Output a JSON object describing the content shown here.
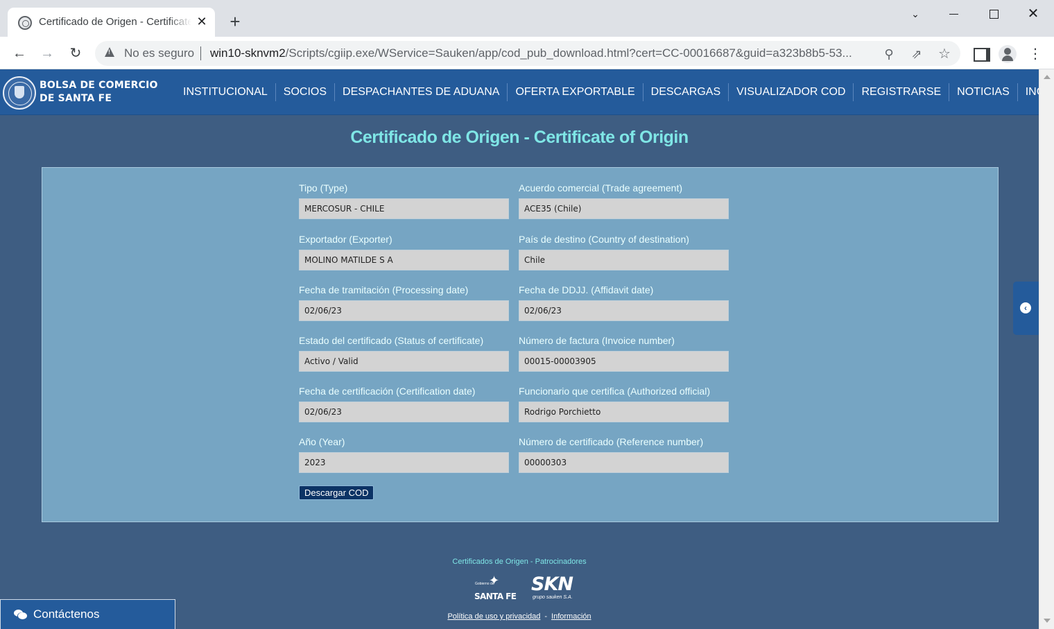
{
  "browser": {
    "tab_title": "Certificado de Origen - Certificate of Origin",
    "tab_close": "✕",
    "new_tab": "+",
    "security_label": "No es seguro",
    "url_host": "win10-sknvm2",
    "url_path": "/Scripts/cgiip.exe/WService=Sauken/app/cod_pub_download.html?cert=CC-00016687&guid=a323b8b5-53..."
  },
  "site": {
    "logo_line1": "BOLSA DE COMERCIO",
    "logo_line2": "DE SANTA FE",
    "nav": [
      "INSTITUCIONAL",
      "SOCIOS",
      "DESPACHANTES DE ADUANA",
      "OFERTA EXPORTABLE",
      "DESCARGAS",
      "VISUALIZADOR COD",
      "REGISTRARSE",
      "NOTICIAS",
      "INGRESAR"
    ]
  },
  "page": {
    "title": "Certificado de Origen - Certificate of Origin"
  },
  "form": {
    "tipo": {
      "label": "Tipo (Type)",
      "value": "MERCOSUR - CHILE"
    },
    "acuerdo": {
      "label": "Acuerdo comercial (Trade agreement)",
      "value": "ACE35 (Chile)"
    },
    "exportador": {
      "label": "Exportador (Exporter)",
      "value": "MOLINO MATILDE S A"
    },
    "pais": {
      "label": "País de destino (Country of destination)",
      "value": "Chile"
    },
    "fecha_tramitacion": {
      "label": "Fecha de tramitación (Processing date)",
      "value": "02/06/23"
    },
    "fecha_ddjj": {
      "label": "Fecha de DDJJ. (Affidavit date)",
      "value": "02/06/23"
    },
    "estado": {
      "label": "Estado del certificado (Status of certificate)",
      "value": "Activo / Valid"
    },
    "factura": {
      "label": "Número de factura (Invoice number)",
      "value": "00015-00003905"
    },
    "fecha_certificacion": {
      "label": "Fecha de certificación (Certification date)",
      "value": "02/06/23"
    },
    "funcionario": {
      "label": "Funcionario que certifica (Authorized official)",
      "value": "Rodrigo Porchietto"
    },
    "anio": {
      "label": "Año (Year)",
      "value": "2023"
    },
    "numero_certificado": {
      "label": "Número de certificado (Reference number)",
      "value": "00000303"
    },
    "download_label": "Descargar COD"
  },
  "footer": {
    "sponsors_title": "Certificados de Origen - Patrocinadores",
    "santafe_small": "Gobierno de",
    "santafe_big": "SANTA FE",
    "skn_big": "SKN",
    "skn_small": "grupo sauken S.A.",
    "link_privacy": "Política de uso y privacidad",
    "link_separator": "-",
    "link_info": "Información"
  },
  "contact": {
    "label": "Contáctenos"
  },
  "colors": {
    "page_bg": "#3e5d82",
    "header_bg": "#245b9b",
    "panel_bg": "#76a5c3",
    "title_color": "#7fe6e6",
    "button_bg": "#0c3365"
  }
}
